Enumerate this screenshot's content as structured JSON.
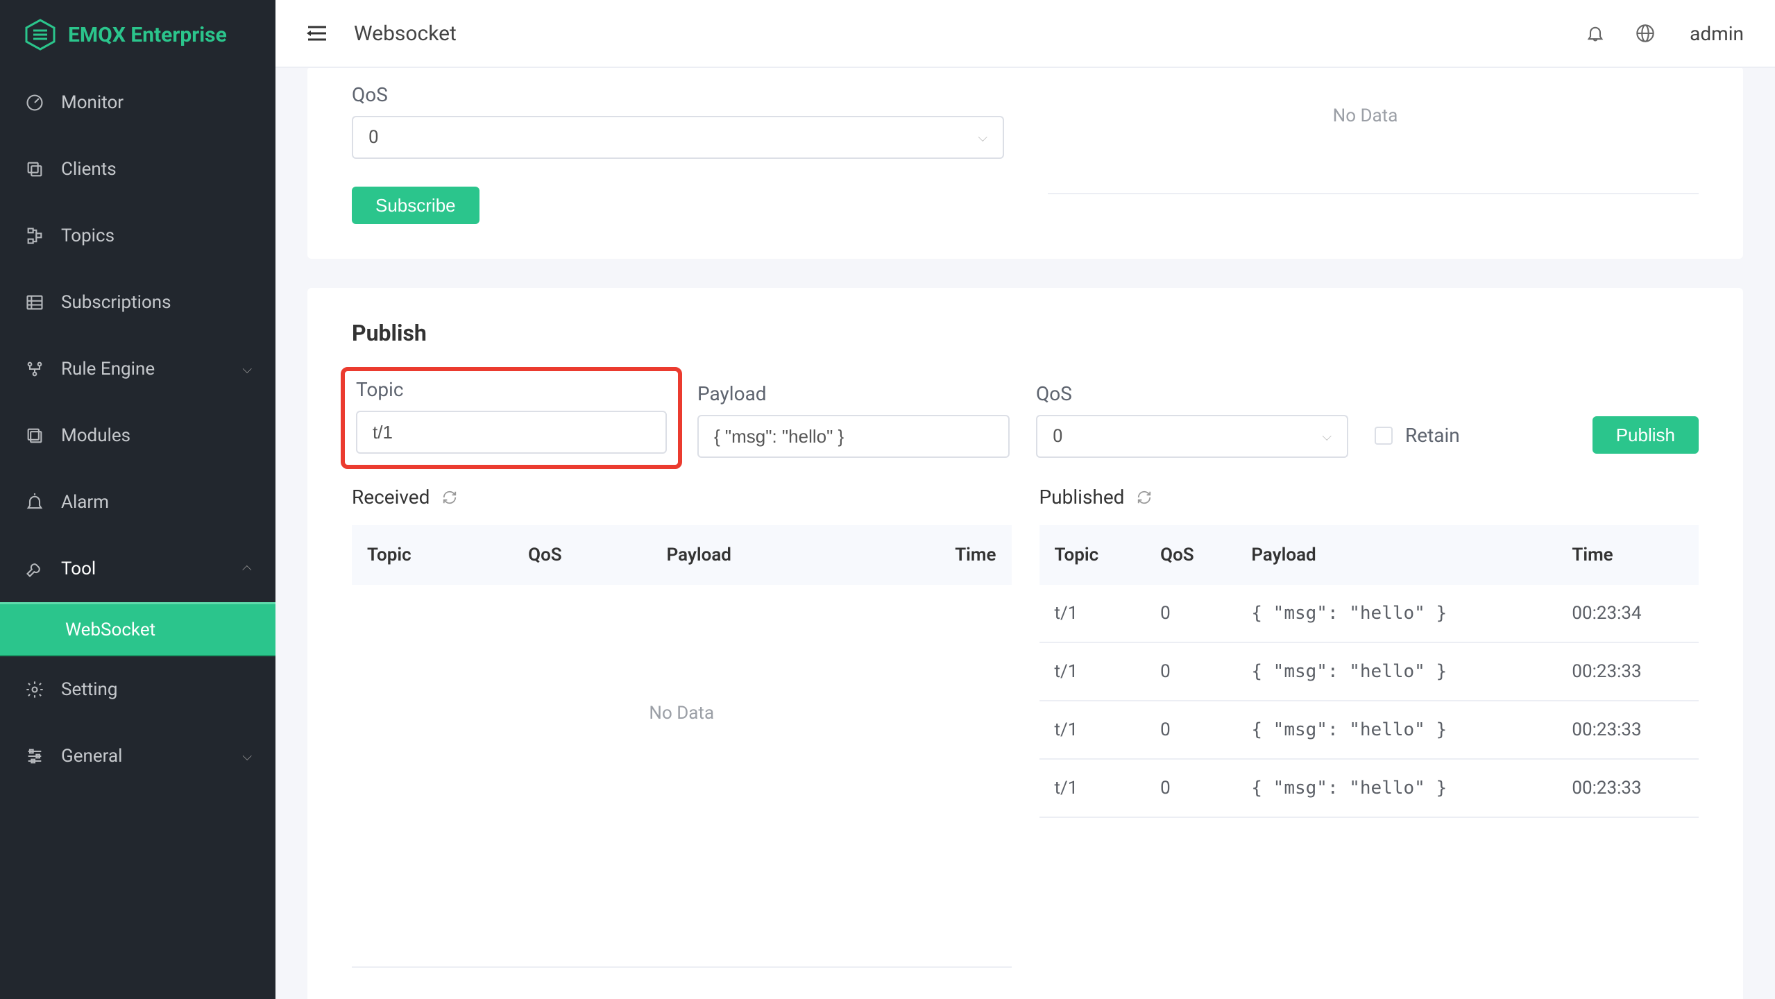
{
  "brand": {
    "name": "EMQX Enterprise"
  },
  "topbar": {
    "title": "Websocket",
    "user": "admin"
  },
  "sidebar": {
    "items": [
      {
        "key": "monitor",
        "label": "Monitor",
        "icon": "gauge"
      },
      {
        "key": "clients",
        "label": "Clients",
        "icon": "copies"
      },
      {
        "key": "topics",
        "label": "Topics",
        "icon": "tree"
      },
      {
        "key": "subscriptions",
        "label": "Subscriptions",
        "icon": "list"
      },
      {
        "key": "rule-engine",
        "label": "Rule Engine",
        "icon": "flow",
        "chev": true
      },
      {
        "key": "modules",
        "label": "Modules",
        "icon": "stack"
      },
      {
        "key": "alarm",
        "label": "Alarm",
        "icon": "bell"
      },
      {
        "key": "tool",
        "label": "Tool",
        "icon": "wrench",
        "chev": true,
        "open": true,
        "children": [
          {
            "key": "websocket",
            "label": "WebSocket",
            "active": true
          }
        ]
      },
      {
        "key": "setting",
        "label": "Setting",
        "icon": "gear"
      },
      {
        "key": "general",
        "label": "General",
        "icon": "sliders",
        "chev": true
      }
    ]
  },
  "subscribe": {
    "qos_label": "QoS",
    "qos_value": "0",
    "subscribe_btn": "Subscribe",
    "no_data": "No Data"
  },
  "publish": {
    "title": "Publish",
    "topic_label": "Topic",
    "topic_value": "t/1",
    "payload_label": "Payload",
    "payload_value": "{ \"msg\": \"hello\" }",
    "qos_label": "QoS",
    "qos_value": "0",
    "retain_label": "Retain",
    "retain_checked": false,
    "publish_btn": "Publish"
  },
  "received": {
    "title": "Received",
    "columns": [
      "Topic",
      "QoS",
      "Payload",
      "Time"
    ],
    "rows": [],
    "empty": "No Data"
  },
  "published": {
    "title": "Published",
    "columns": [
      "Topic",
      "QoS",
      "Payload",
      "Time"
    ],
    "rows": [
      {
        "topic": "t/1",
        "qos": "0",
        "payload": "{ \"msg\": \"hello\" }",
        "time": "00:23:34"
      },
      {
        "topic": "t/1",
        "qos": "0",
        "payload": "{ \"msg\": \"hello\" }",
        "time": "00:23:33"
      },
      {
        "topic": "t/1",
        "qos": "0",
        "payload": "{ \"msg\": \"hello\" }",
        "time": "00:23:33"
      },
      {
        "topic": "t/1",
        "qos": "0",
        "payload": "{ \"msg\": \"hello\" }",
        "time": "00:23:33"
      }
    ]
  }
}
